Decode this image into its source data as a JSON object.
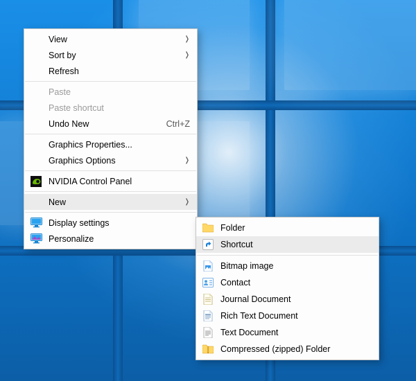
{
  "main_menu": {
    "view": {
      "label": "View"
    },
    "sort_by": {
      "label": "Sort by"
    },
    "refresh": {
      "label": "Refresh"
    },
    "paste": {
      "label": "Paste"
    },
    "paste_shortcut": {
      "label": "Paste shortcut"
    },
    "undo": {
      "label": "Undo New",
      "hint": "Ctrl+Z"
    },
    "gfx_props": {
      "label": "Graphics Properties..."
    },
    "gfx_options": {
      "label": "Graphics Options"
    },
    "nvidia": {
      "label": "NVIDIA Control Panel"
    },
    "new": {
      "label": "New"
    },
    "display": {
      "label": "Display settings"
    },
    "personalize": {
      "label": "Personalize"
    }
  },
  "new_menu": {
    "folder": {
      "label": "Folder"
    },
    "shortcut": {
      "label": "Shortcut"
    },
    "bitmap": {
      "label": "Bitmap image"
    },
    "contact": {
      "label": "Contact"
    },
    "journal": {
      "label": "Journal Document"
    },
    "rtf": {
      "label": "Rich Text Document"
    },
    "text": {
      "label": "Text Document"
    },
    "zip": {
      "label": "Compressed (zipped) Folder"
    }
  }
}
